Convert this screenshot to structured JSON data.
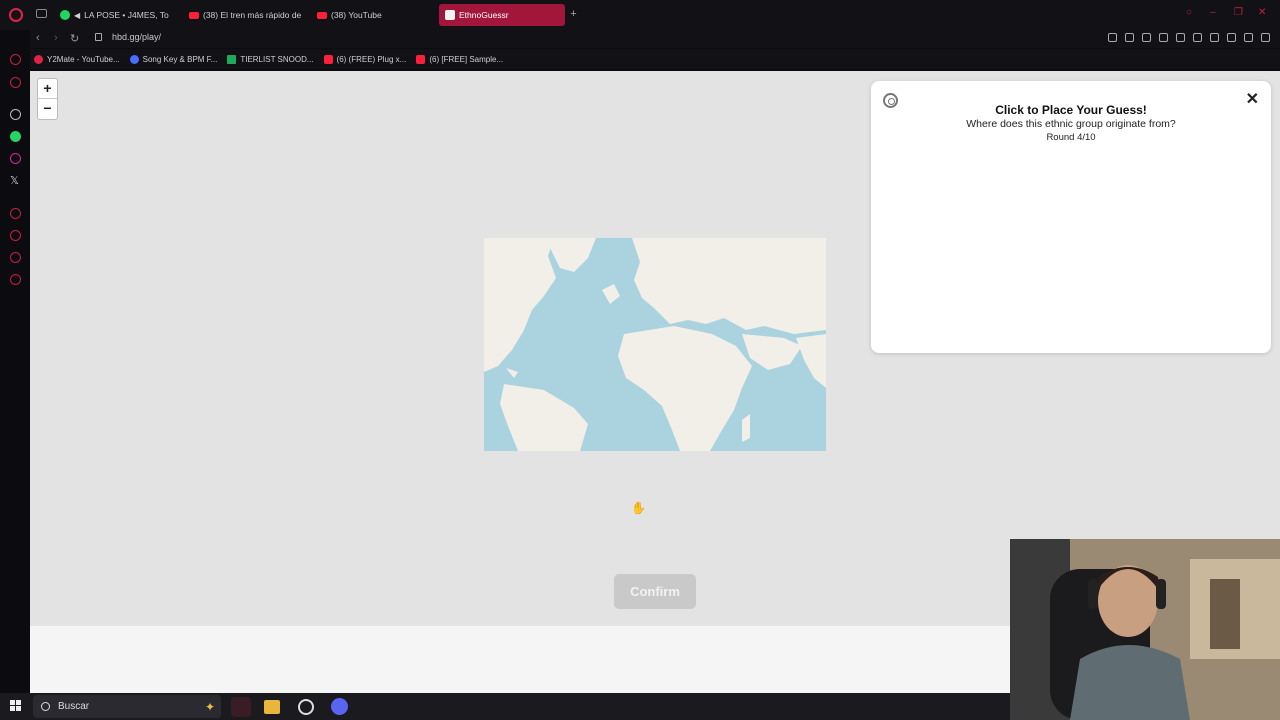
{
  "browser": {
    "tabs": [
      {
        "label": "LA POSE • J4MES, To",
        "icon": "spotify-icon"
      },
      {
        "label": "(38) El tren más rápido de",
        "icon": "youtube-icon"
      },
      {
        "label": "(38) YouTube",
        "icon": "youtube-icon"
      },
      {
        "label": "EthnoGuessr",
        "icon": "ethnoguessr-icon",
        "active": true
      }
    ],
    "url": "hbd.gg/play/",
    "bookmarks": [
      {
        "label": "Y2Mate - YouTube...",
        "color": "#e0224a"
      },
      {
        "label": "Song Key & BPM F...",
        "color": "#4a6cff"
      },
      {
        "label": "TIERLIST SNOOD...",
        "color": "#1faa59"
      },
      {
        "label": "(6) (FREE) Plug x...",
        "color": "#ff1f3a"
      },
      {
        "label": "(6) [FREE] Sample...",
        "color": "#ff1f3a"
      }
    ]
  },
  "game": {
    "title": "Click to Place Your Guess!",
    "question": "Where does this ethnic group originate from?",
    "round": "Round 4/10",
    "confirm_label": "Confirm",
    "zoom_in": "+",
    "zoom_out": "−",
    "close": "✕"
  },
  "taskbar": {
    "search_placeholder": "Buscar"
  },
  "colors": {
    "accent": "#a1163a",
    "opera_red": "#e0224a",
    "ocean": "#aad3df",
    "land": "#f2efe9"
  }
}
